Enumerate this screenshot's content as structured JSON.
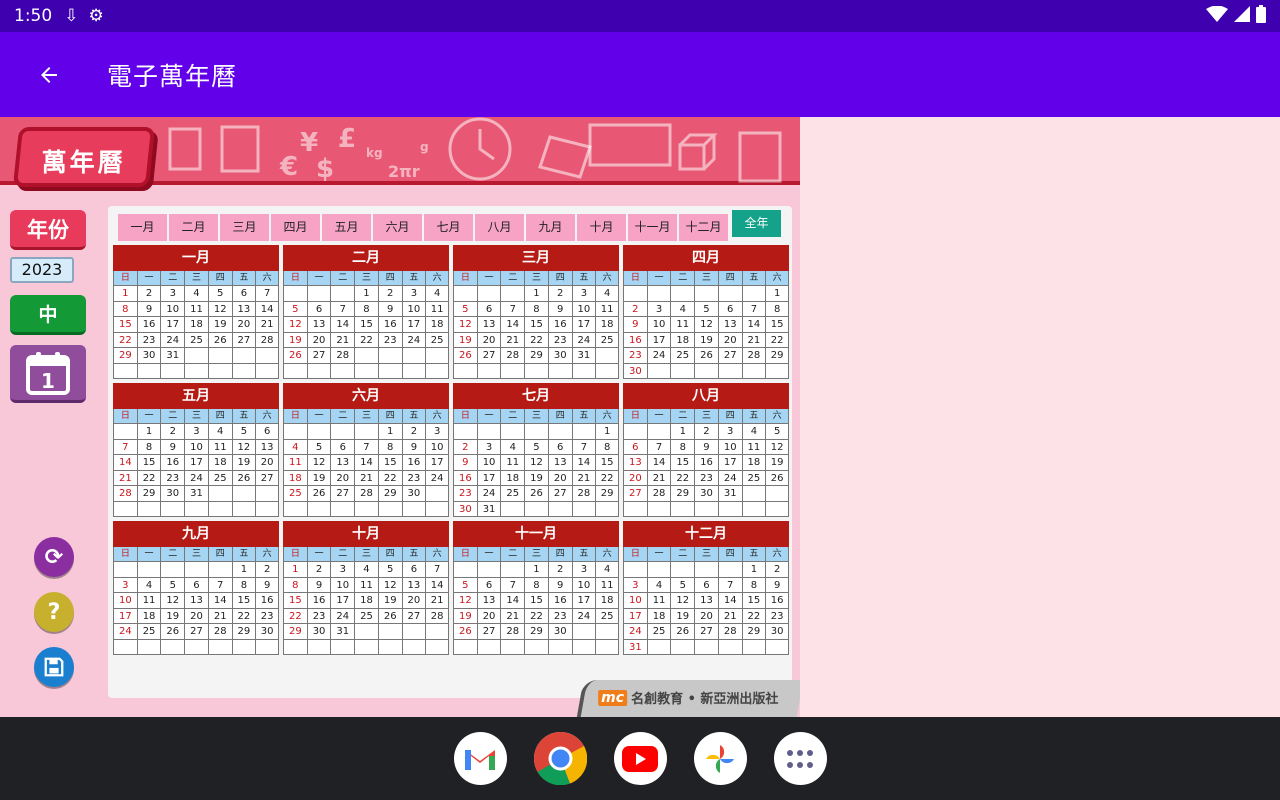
{
  "status_bar": {
    "time": "1:50"
  },
  "app_bar": {
    "title": "電子萬年曆"
  },
  "banner": {
    "logo_text": "萬年曆"
  },
  "sidebar": {
    "year_button": "年份",
    "year_value": "2023",
    "lang_button": "中",
    "calendar_day": "1"
  },
  "tabs": [
    "一月",
    "二月",
    "三月",
    "四月",
    "五月",
    "六月",
    "七月",
    "八月",
    "九月",
    "十月",
    "十一月",
    "十二月"
  ],
  "all_tab": "全年",
  "weekdays": [
    "日",
    "一",
    "二",
    "三",
    "四",
    "五",
    "六"
  ],
  "months": [
    {
      "name": "一月",
      "offset": 0,
      "days": 31
    },
    {
      "name": "二月",
      "offset": 3,
      "days": 28
    },
    {
      "name": "三月",
      "offset": 3,
      "days": 31
    },
    {
      "name": "四月",
      "offset": 6,
      "days": 30
    },
    {
      "name": "五月",
      "offset": 1,
      "days": 31
    },
    {
      "name": "六月",
      "offset": 4,
      "days": 30
    },
    {
      "name": "七月",
      "offset": 6,
      "days": 31
    },
    {
      "name": "八月",
      "offset": 2,
      "days": 31
    },
    {
      "name": "九月",
      "offset": 5,
      "days": 30
    },
    {
      "name": "十月",
      "offset": 0,
      "days": 31
    },
    {
      "name": "十一月",
      "offset": 3,
      "days": 30
    },
    {
      "name": "十二月",
      "offset": 5,
      "days": 31
    }
  ],
  "publisher": {
    "logo": "mc",
    "text": "名創教育 • 新亞洲出版社"
  },
  "icons": [
    "back-arrow-icon",
    "refresh-icon",
    "help-icon",
    "save-icon",
    "gmail-icon",
    "chrome-icon",
    "youtube-icon",
    "photos-icon",
    "apps-icon"
  ]
}
